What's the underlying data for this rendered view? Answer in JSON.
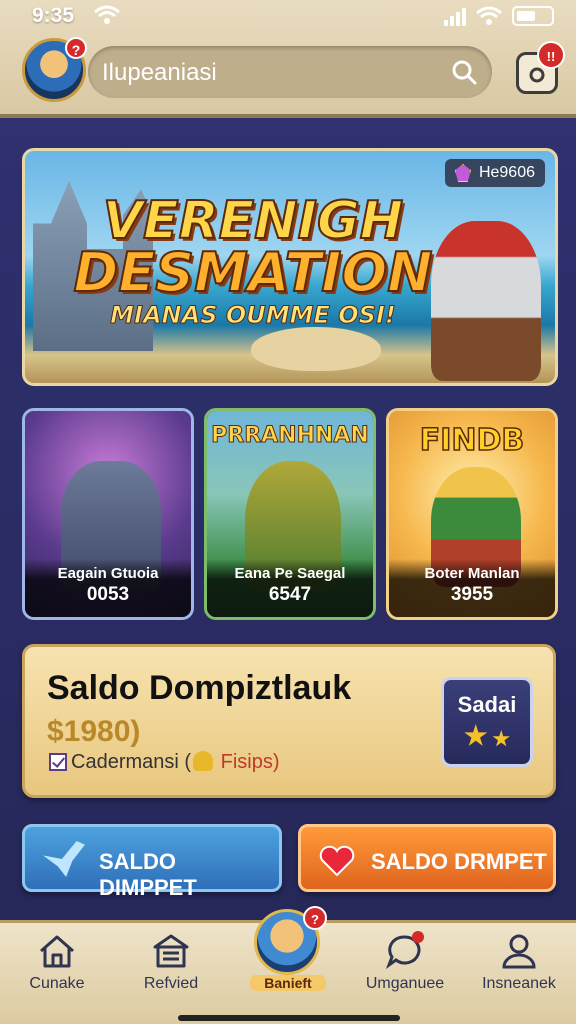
{
  "status_bar": {
    "time": "9:35"
  },
  "header": {
    "avatar_badge": "?",
    "search_text": "Ilupeaniasi",
    "camera_badge": "!!"
  },
  "hero": {
    "title_line1": "VERENIGH",
    "title_line2": "DESMATION",
    "subtitle": "MIANAS OUMME OSI!",
    "badge_text": "He9606"
  },
  "cards": [
    {
      "title": "",
      "name": "Eagain Gtuoia",
      "number": "0053"
    },
    {
      "title": "PRRANHNAN",
      "name": "Eana Pe Saegal",
      "number": "6547"
    },
    {
      "title": "FINDB",
      "name": "Boter Manlan",
      "number": "3955"
    }
  ],
  "balance": {
    "title": "Saldo Dompiztlauk",
    "amount": "$1980)",
    "note_text": "Cadermansi (",
    "note_extra": "Fisips)",
    "button_label": "Sadai"
  },
  "actions": {
    "left_label": "SALDO DIMPPET",
    "right_label": "SALDO DRMPET"
  },
  "nav": {
    "items": [
      {
        "label": "Cunake"
      },
      {
        "label": "Refvied"
      },
      {
        "label": "Banieft"
      },
      {
        "label": "Umganuee"
      },
      {
        "label": "Insneanek"
      }
    ],
    "center_badge": "?"
  },
  "colors": {
    "header_bg": "#e3d4b3",
    "main_bg": "#2b2c5e",
    "gold": "#c9a45c",
    "blue_button": "#3f8ad0",
    "orange_button": "#ef7b28"
  }
}
